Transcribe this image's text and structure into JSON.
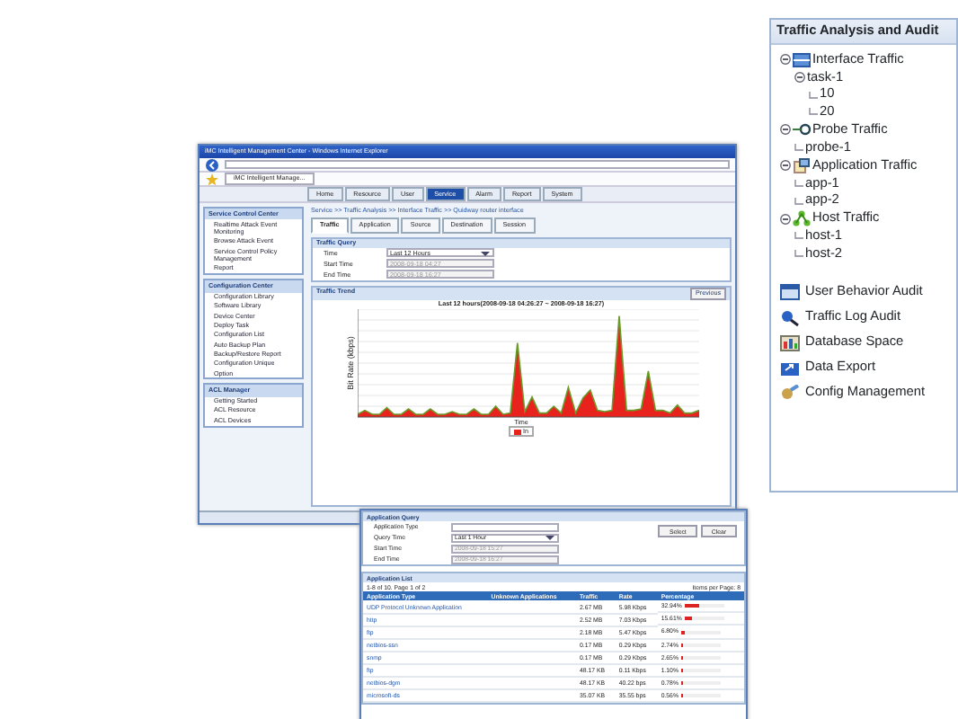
{
  "main_window": {
    "title": "iMC Intelligent Management Center - Windows Internet Explorer",
    "browser_tab": "iMC Intelligent Manage...",
    "menu_tabs": [
      {
        "label": "Home",
        "selected": false
      },
      {
        "label": "Resource",
        "selected": false
      },
      {
        "label": "User",
        "selected": false
      },
      {
        "label": "Service",
        "selected": true
      },
      {
        "label": "Alarm",
        "selected": false
      },
      {
        "label": "Report",
        "selected": false
      },
      {
        "label": "System",
        "selected": false
      }
    ],
    "sidebar": [
      {
        "title": "Service Control Center",
        "items": [
          "Realtime Attack Event Monitoring",
          "Browse Attack Event",
          "Service Control Policy Management",
          "Report"
        ]
      },
      {
        "title": "Configuration Center",
        "items": [
          "Configuration Library",
          "Software Library",
          "Device Center",
          "Deploy Task",
          "Configuration List",
          "Auto Backup Plan",
          "Backup/Restore Report",
          "Configuration Unique",
          "Option"
        ]
      },
      {
        "title": "ACL Manager",
        "items": [
          "Getting Started",
          "ACL Resource",
          "ACL Devices"
        ]
      }
    ],
    "breadcrumb": "Service >> Traffic Analysis >> Interface Traffic >> Quidway router interface",
    "tabs": [
      {
        "label": "Traffic",
        "selected": true
      },
      {
        "label": "Application",
        "selected": false
      },
      {
        "label": "Source",
        "selected": false
      },
      {
        "label": "Destination",
        "selected": false
      },
      {
        "label": "Session",
        "selected": false
      }
    ],
    "query": {
      "title": "Traffic Query",
      "fields": [
        {
          "label": "Time",
          "value": "Last 12 Hours",
          "kind": "select"
        },
        {
          "label": "Start Time",
          "value": "2008-09-18 04:27",
          "kind": "text",
          "disabled": true
        },
        {
          "label": "End Time",
          "value": "2008-09-18 16:27",
          "kind": "text",
          "disabled": true
        }
      ]
    },
    "trend": {
      "title": "Traffic Trend",
      "button": "Previous",
      "chart_title": "Last 12 hours(2008-09-18 04:26:27 ~ 2008-09-18 16:27)",
      "ylabel": "Bit Rate (kbps)",
      "xlabel": "Time",
      "legend": "In"
    }
  },
  "app_window": {
    "query": {
      "title": "Application Query",
      "fields": [
        {
          "label": "Application Type",
          "kind": "text"
        },
        {
          "label": "Query Time",
          "value": "Last 1 Hour",
          "kind": "select"
        },
        {
          "label": "Start Time",
          "value": "2008-09-18 15:27",
          "kind": "text",
          "disabled": true
        },
        {
          "label": "End Time",
          "value": "2008-09-18 16:27",
          "kind": "text",
          "disabled": true
        }
      ],
      "buttons": [
        "Select",
        "Clear"
      ]
    },
    "list": {
      "title": "Application List",
      "pager": "1-8 of 10. Page 1 of 2",
      "page_size": "Items per Page: 8",
      "columns": [
        "Application Type",
        "Unknown Applications",
        "Traffic",
        "Rate",
        "Percentage"
      ],
      "rows": [
        {
          "cells": [
            "UDP Protocol Unknown Application",
            "",
            "2.67 MB",
            "5.98 Kbps",
            "32.94%"
          ],
          "level": 0.33
        },
        {
          "cells": [
            "http",
            "",
            "2.52 MB",
            "7.03 Kbps",
            "15.61%"
          ],
          "level": 0.16
        },
        {
          "cells": [
            "ftp",
            "",
            "2.18 MB",
            "5.47 Kbps",
            "6.80%"
          ],
          "level": 0.07
        },
        {
          "cells": [
            "netbios-ssn",
            "",
            "0.17 MB",
            "0.29 Kbps",
            "2.74%"
          ],
          "level": 0.03
        },
        {
          "cells": [
            "snmp",
            "",
            "0.17 MB",
            "0.29 Kbps",
            "2.65%"
          ],
          "level": 0.03
        },
        {
          "cells": [
            "ftp",
            "",
            "48.17 KB",
            "0.11 Kbps",
            "1.10%"
          ],
          "level": 0.01
        },
        {
          "cells": [
            "netbios-dgm",
            "",
            "48.17 KB",
            "40.22 bps",
            "0.78%"
          ],
          "level": 0.01
        },
        {
          "cells": [
            "microsoft-ds",
            "",
            "35.07 KB",
            "35.55 bps",
            "0.56%"
          ],
          "level": 0.01
        }
      ]
    }
  },
  "audit_panel": {
    "title": "Traffic Analysis and Audit",
    "tree": [
      {
        "label": "Interface Traffic",
        "kind": "interface",
        "expanded": true,
        "children": [
          {
            "label": "task-1",
            "expanded": true,
            "children": [
              {
                "label": "10"
              },
              {
                "label": "20"
              }
            ]
          }
        ]
      },
      {
        "label": "Probe Traffic",
        "kind": "probe",
        "expanded": true,
        "children": [
          {
            "label": "probe-1"
          }
        ]
      },
      {
        "label": "Application Traffic",
        "kind": "application",
        "expanded": true,
        "children": [
          {
            "label": "app-1"
          },
          {
            "label": "app-2"
          }
        ]
      },
      {
        "label": "Host Traffic",
        "kind": "host",
        "expanded": true,
        "children": [
          {
            "label": "host-1"
          },
          {
            "label": "host-2"
          }
        ]
      }
    ],
    "links": [
      {
        "label": "User Behavior Audit",
        "kind": "user"
      },
      {
        "label": "Traffic Log Audit",
        "kind": "log"
      },
      {
        "label": "Database Space",
        "kind": "database"
      },
      {
        "label": "Data Export",
        "kind": "export"
      },
      {
        "label": "Config Management",
        "kind": "config"
      }
    ]
  }
}
